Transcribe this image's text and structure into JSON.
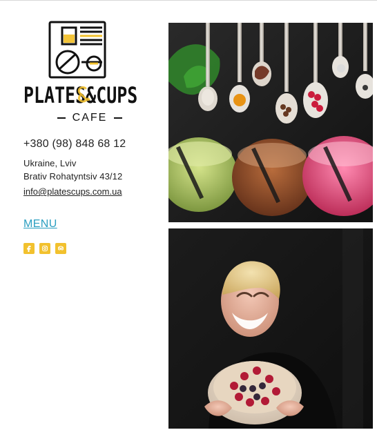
{
  "brand": {
    "wordmark": "PLATES&CUPS",
    "subtitle": "CAFE"
  },
  "contact": {
    "phone": "+380 (98) 848 68 12",
    "address_line1": "Ukraine, Lviv",
    "address_line2": "Brativ Rohatyntsiv 43/12",
    "email": "info@platescups.com.ua"
  },
  "nav": {
    "menu_label": "MENU"
  },
  "social": {
    "items": [
      {
        "name": "facebook-icon"
      },
      {
        "name": "instagram-icon"
      },
      {
        "name": "tripadvisor-icon"
      }
    ],
    "accent_color": "#f2c12e"
  },
  "images": {
    "top_alt": "",
    "bottom_alt": ""
  },
  "colors": {
    "link": "#2a9ec0",
    "text": "#222222"
  }
}
